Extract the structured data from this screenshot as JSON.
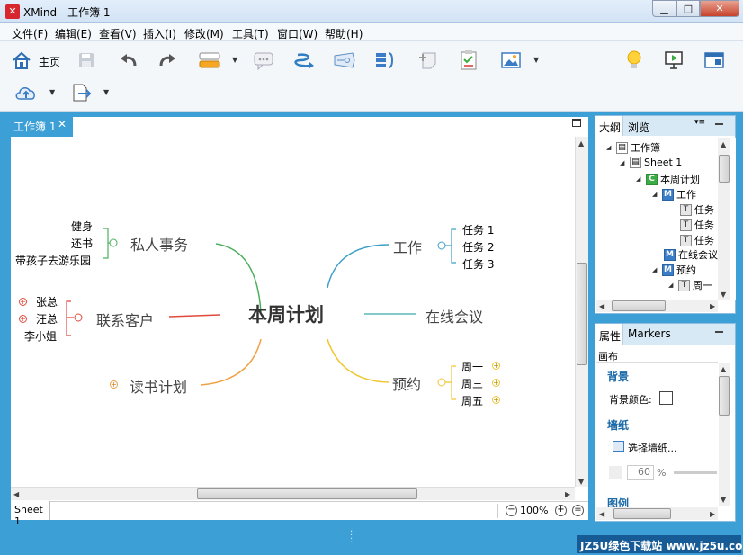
{
  "window": {
    "title": "XMind - 工作簿 1",
    "logo_glyph": "✕"
  },
  "menu": [
    "文件(F)",
    "编辑(E)",
    "查看(V)",
    "插入(I)",
    "修改(M)",
    "工具(T)",
    "窗口(W)",
    "帮助(H)"
  ],
  "toolbar": {
    "home_label": "主页"
  },
  "editor": {
    "tab_label": "工作簿 1",
    "tab_close": "✕",
    "sheet_tab": "Sheet 1",
    "zoom_level": "100%",
    "zoom_out": "−",
    "zoom_in": "+",
    "zoom_fit": "="
  },
  "mindmap": {
    "central": "本周计划",
    "branches": {
      "personal": {
        "label": "私人事务",
        "children": [
          "健身",
          "还书",
          "带孩子去游乐园"
        ],
        "color": "#4bb05d"
      },
      "contacts": {
        "label": "联系客户",
        "children": [
          "张总",
          "汪总",
          "李小姐"
        ],
        "color": "#e04a3c"
      },
      "reading": {
        "label": "读书计划",
        "children": [],
        "color": "#f0a040"
      },
      "work": {
        "label": "工作",
        "children": [
          "任务 1",
          "任务 2",
          "任务 3"
        ],
        "color": "#3c9fc6"
      },
      "meeting": {
        "label": "在线会议",
        "children": [],
        "color": "#5bb8b8"
      },
      "booking": {
        "label": "预约",
        "children": [
          "周一",
          "周三",
          "周五"
        ],
        "color": "#f0c630"
      }
    }
  },
  "outline": {
    "tabs": [
      "大纲",
      "浏览"
    ],
    "rows": [
      {
        "text": "工作簿",
        "icon": "workbook-icon"
      },
      {
        "text": "Sheet 1",
        "icon": "sheet-icon"
      },
      {
        "text": "本周计划",
        "icon": "central-topic-icon",
        "glyph": "C"
      },
      {
        "text": "工作",
        "icon": "main-topic-icon",
        "glyph": "M"
      },
      {
        "text": "任务",
        "icon": "topic-icon",
        "glyph": "T"
      },
      {
        "text": "任务",
        "icon": "topic-icon",
        "glyph": "T"
      },
      {
        "text": "任务",
        "icon": "topic-icon",
        "glyph": "T"
      },
      {
        "text": "在线会议",
        "icon": "main-topic-icon",
        "glyph": "M"
      },
      {
        "text": "预约",
        "icon": "main-topic-icon",
        "glyph": "M"
      },
      {
        "text": "周一",
        "icon": "topic-icon",
        "glyph": "T"
      }
    ]
  },
  "properties": {
    "tabs": [
      "属性",
      "Markers"
    ],
    "section_title": "画布",
    "background_head": "背景",
    "background_color_label": "背景颜色:",
    "wallpaper_head": "墙纸",
    "select_wallpaper": "选择墙纸...",
    "opacity_value": "60",
    "opacity_unit": "%",
    "legend_head": "图例"
  },
  "watermark": "JZ5U绿色下载站 www.jz5u.com",
  "colors": {
    "accent": "#3c9fd6",
    "title_bar": "#dbe8f6"
  }
}
